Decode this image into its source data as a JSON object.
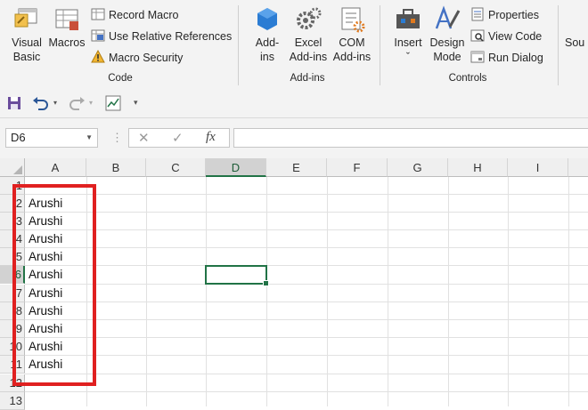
{
  "ribbon": {
    "code_group": {
      "label": "Code",
      "visual_basic": "Visual\nBasic",
      "visual_basic_l1": "Visual",
      "visual_basic_l2": "Basic",
      "macros": "Macros",
      "record_macro": "Record Macro",
      "use_relative_references": "Use Relative References",
      "macro_security": "Macro Security"
    },
    "addins_group": {
      "label": "Add-ins",
      "addins_l1": "Add-",
      "addins_l2": "ins",
      "excel_addins_l1": "Excel",
      "excel_addins_l2": "Add-ins",
      "com_addins_l1": "COM",
      "com_addins_l2": "Add-ins"
    },
    "controls_group": {
      "label": "Controls",
      "insert": "Insert",
      "insert_caret": "ˇ",
      "design_mode_l1": "Design",
      "design_mode_l2": "Mode",
      "properties": "Properties",
      "view_code": "View Code",
      "run_dialog": "Run Dialog"
    },
    "source_partial": "Sou"
  },
  "name_box": {
    "value": "D6"
  },
  "formula_bar": {
    "cancel_glyph": "✕",
    "enter_glyph": "✓",
    "fx_glyph": "fx",
    "value": ""
  },
  "columns": [
    "A",
    "B",
    "C",
    "D",
    "E",
    "F",
    "G",
    "H",
    "I"
  ],
  "rows": [
    "1",
    "2",
    "3",
    "4",
    "5",
    "6",
    "7",
    "8",
    "9",
    "10",
    "11",
    "12",
    "13"
  ],
  "selected_cell": {
    "col": "D",
    "row": "6"
  },
  "cells_A": [
    "",
    "Arushi",
    "Arushi",
    "Arushi",
    "Arushi",
    "Arushi",
    "Arushi",
    "Arushi",
    "Arushi",
    "Arushi",
    "Arushi",
    "",
    ""
  ],
  "colors": {
    "accent_green": "#217346",
    "highlight_red": "#e02020"
  }
}
